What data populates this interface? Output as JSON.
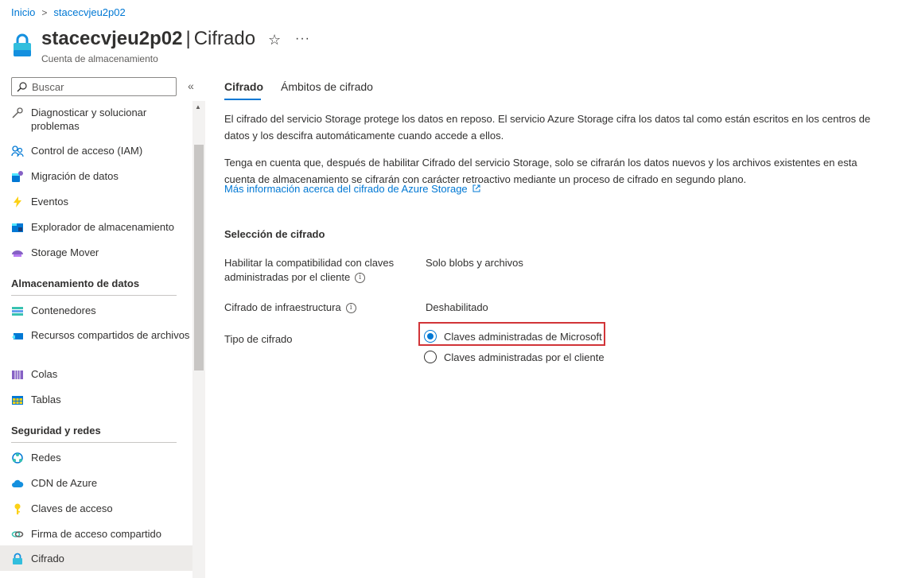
{
  "breadcrumb": {
    "home": "Inicio",
    "current": "stacecvjeu2p02"
  },
  "header": {
    "resource_name": "stacecvjeu2p02",
    "separator": "|",
    "page_name": "Cifrado",
    "subtitle": "Cuenta de almacenamiento",
    "favorite_icon": "☆",
    "more_icon": "···"
  },
  "search": {
    "placeholder": "Buscar",
    "collapse_icon": "«"
  },
  "sidebar": {
    "items_top": [
      {
        "label": "Diagnosticar y solucionar problemas",
        "icon": "wrench-icon"
      },
      {
        "label": "Control de acceso (IAM)",
        "icon": "people-icon"
      },
      {
        "label": "Migración de datos",
        "icon": "migration-icon"
      },
      {
        "label": "Eventos",
        "icon": "lightning-icon"
      },
      {
        "label": "Explorador de almacenamiento",
        "icon": "storage-explorer-icon"
      },
      {
        "label": "Storage Mover",
        "icon": "storage-mover-icon"
      }
    ],
    "section_data": "Almacenamiento de datos",
    "items_data": [
      {
        "label": "Contenedores",
        "icon": "containers-icon"
      },
      {
        "label": "Recursos compartidos de archivos",
        "icon": "file-shares-icon"
      },
      {
        "label": "Colas",
        "icon": "queues-icon"
      },
      {
        "label": "Tablas",
        "icon": "tables-icon"
      }
    ],
    "section_security": "Seguridad y redes",
    "items_security": [
      {
        "label": "Redes",
        "icon": "networking-icon"
      },
      {
        "label": "CDN de Azure",
        "icon": "cloud-icon"
      },
      {
        "label": "Claves de acceso",
        "icon": "key-icon"
      },
      {
        "label": "Firma de acceso compartido",
        "icon": "link-icon"
      },
      {
        "label": "Cifrado",
        "icon": "lock-icon",
        "active": true
      }
    ]
  },
  "tabs": [
    {
      "label": "Cifrado",
      "active": true
    },
    {
      "label": "Ámbitos de cifrado",
      "active": false
    }
  ],
  "content": {
    "para1": "El cifrado del servicio Storage protege los datos en reposo. El servicio Azure Storage cifra los datos tal como están escritos en los centros de datos y los descifra automáticamente cuando accede a ellos.",
    "para2": "Tenga en cuenta que, después de habilitar Cifrado del servicio Storage, solo se cifrarán los datos nuevos y los archivos existentes en esta cuenta de almacenamiento se cifrarán con carácter retroactivo mediante un proceso de cifrado en segundo plano.",
    "learn_more": "Más información acerca del cifrado de Azure Storage",
    "section_title": "Selección de cifrado",
    "row1_label_line1": "Habilitar la compatibilidad con claves",
    "row1_label_line2": "administradas por el cliente",
    "row1_value": "Solo blobs y archivos",
    "row2_label": "Cifrado de infraestructura",
    "row2_value": "Deshabilitado",
    "row3_label": "Tipo de cifrado",
    "option_microsoft": "Claves administradas de Microsoft",
    "option_customer": "Claves administradas por el cliente",
    "selected_option": "option_microsoft"
  },
  "colors": {
    "accent": "#0078d4",
    "highlight": "#d13438"
  }
}
